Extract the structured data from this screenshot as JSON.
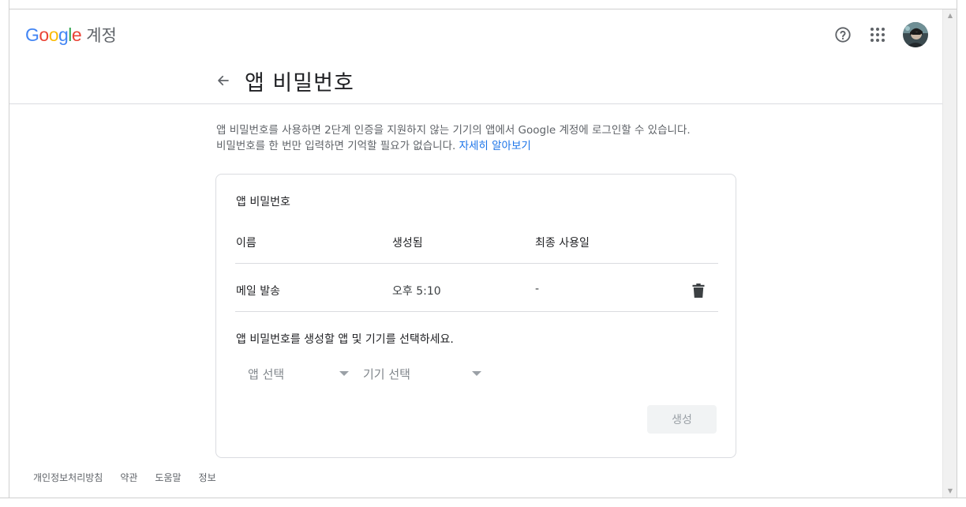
{
  "header": {
    "logo_letters": [
      "G",
      "o",
      "o",
      "g",
      "l",
      "e"
    ],
    "logo_colors": [
      "#4285F4",
      "#EA4335",
      "#FBBC05",
      "#4285F4",
      "#34A853",
      "#EA4335"
    ],
    "product_name": "계정",
    "help_icon": "help-circle-icon",
    "apps_icon": "apps-grid-icon"
  },
  "page": {
    "title": "앱 비밀번호",
    "description_line1": "앱 비밀번호를 사용하면 2단계 인증을 지원하지 않는 기기의 앱에서 Google 계정에 로그인할 수 있습니다.",
    "description_line2": "비밀번호를 한 번만 입력하면 기억할 필요가 없습니다.",
    "learn_more": "자세히 알아보기",
    "link_color": "#1a73e8"
  },
  "card": {
    "title": "앱 비밀번호",
    "columns": [
      "이름",
      "생성됨",
      "최종 사용일"
    ],
    "rows": [
      {
        "name": "메일 발송",
        "created": "오후 5:10",
        "last_used": "-"
      }
    ],
    "select_prompt": "앱 비밀번호를 생성할 앱 및 기기를 선택하세요.",
    "app_select": "앱 선택",
    "device_select": "기기 선택",
    "generate_label": "생성"
  },
  "footer": {
    "links": [
      "개인정보처리방침",
      "약관",
      "도움말",
      "정보"
    ]
  }
}
